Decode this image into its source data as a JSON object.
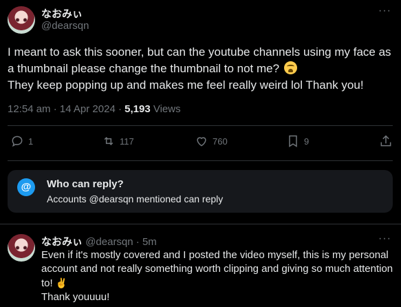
{
  "tweet": {
    "display_name": "なおみぃ",
    "handle": "@dearsqn",
    "more_label": "···",
    "lines": [
      "I meant to ask this sooner, but can the youtube channels using my face as a thumbnail please change the thumbnail to not me?",
      "They keep popping up and makes me feel really weird lol Thank you!"
    ],
    "emoji_name": "loudly-crying-face",
    "time": "12:54 am",
    "dot": " · ",
    "date": "14 Apr 2024",
    "views_count": "5,193",
    "views_label": "Views"
  },
  "actions": {
    "replies": "1",
    "reposts": "117",
    "likes": "760",
    "bookmarks": "9"
  },
  "who_can_reply": {
    "icon": "@",
    "title": "Who can reply?",
    "subtitle": "Accounts @dearsqn mentioned can reply"
  },
  "reply": {
    "display_name": "なおみぃ",
    "handle": "@dearsqn",
    "time": "5m",
    "more_label": "···",
    "line1": "Even if it's mostly covered and I posted the video myself, this is my personal account and not really something worth clipping and giving so much attention to!",
    "victory_emoji": "✌️",
    "line2": "Thank youuuu!"
  },
  "colors": {
    "background": "#000000",
    "text": "#e7e9ea",
    "muted": "#71767b",
    "accent": "#1d9bf0",
    "card": "#16181c",
    "border": "#2f3336"
  }
}
